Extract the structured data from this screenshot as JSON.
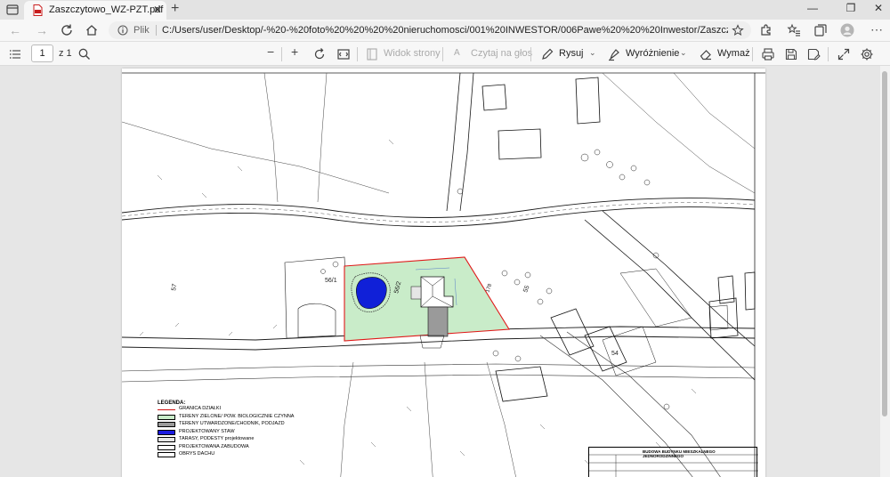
{
  "browser": {
    "tab": {
      "title": "Zaszczytowo_WZ-PZT.pdf",
      "close_glyph": "✕"
    },
    "new_tab_glyph": "+",
    "window_controls": {
      "minimize": "—",
      "restore": "❐",
      "close": "✕"
    },
    "address": {
      "scheme_label": "Plik",
      "url": "C:/Users/user/Desktop/-%20-%20foto%20%20%20%20nieruchomosci/001%20INWESTOR/006Pawe%20%20%20Inwestor/Zaszczytowo%2017/DZIA%2056..."
    }
  },
  "pdf_toolbar": {
    "page_current": "1",
    "page_total": "z 1",
    "page_view_label": "Widok strony",
    "read_aloud_label": "Czytaj na głos",
    "draw_label": "Rysuj",
    "highlight_label": "Wyróżnienie",
    "erase_label": "Wymaż"
  },
  "document": {
    "legend": {
      "title": "LEGENDA:",
      "items": [
        {
          "label": "GRANICA DZIAŁKI",
          "color": "#ffffff",
          "border": "#d01010"
        },
        {
          "label": "TERENY ZIELONE/ POW. BIOLOGICZNIE CZYNNA",
          "color": "#c9ecc9",
          "border": "#000000"
        },
        {
          "label": "TERENY UTWARDZONE/CHODNIK, PODJAZD",
          "color": "#9a9a9a",
          "border": "#000000"
        },
        {
          "label": "PROJEKTOWANY STAW",
          "color": "#1a1adf",
          "border": "#000000"
        },
        {
          "label": "TARASY, PODESTY projektowane",
          "color": "#e6e6e6",
          "border": "#000000"
        },
        {
          "label": "PROJEKTOWANA ZABUDOWA",
          "color": "#ffffff",
          "border": "#000000"
        },
        {
          "label": "OBRYS DACHU",
          "color": "#ffffff",
          "border": "#000000"
        }
      ]
    },
    "title_block": {
      "title": "BUDOWA BUDYNKU MIESZKALNEGO JEDNORODZINNEGO"
    },
    "parcel_labels": [
      "56/1",
      "56/2",
      "55",
      "54",
      "57",
      "178"
    ],
    "colors": {
      "plot_fill": "#c9ecc9",
      "boundary": "#e01818",
      "pond": "#1020d8",
      "line": "#1a1a1a"
    }
  }
}
